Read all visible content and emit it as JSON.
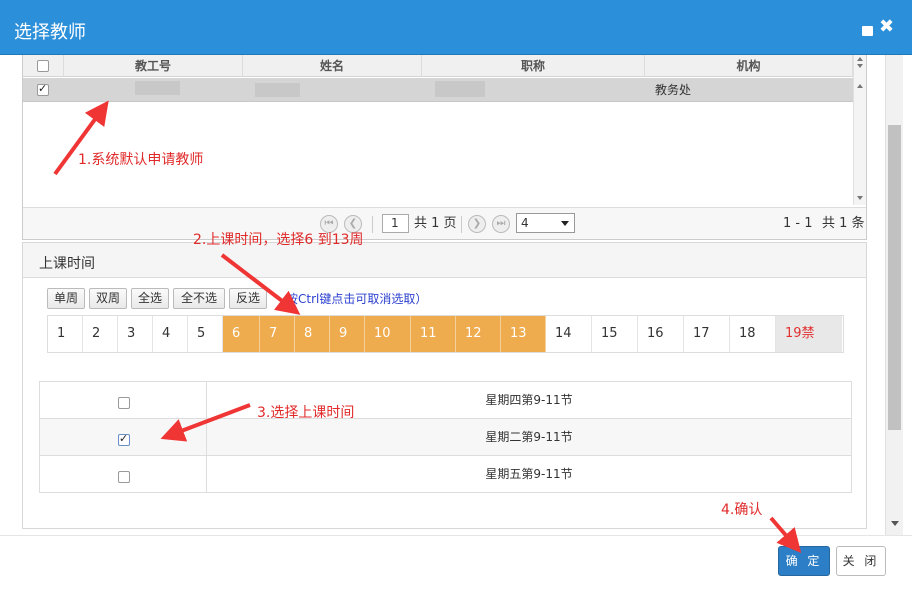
{
  "dialog": {
    "title": "选择教师",
    "icons": {
      "maximize": "square-icon",
      "close": "close-x-icon"
    }
  },
  "teacher_grid": {
    "columns": [
      "教工号",
      "姓名",
      "职称",
      "机构"
    ],
    "rows": [
      {
        "checked": true,
        "id": "",
        "name": "",
        "title": "",
        "org": "教务处"
      }
    ]
  },
  "pager": {
    "page": "1",
    "total_pages_text": "共 1 页",
    "page_size": "4",
    "range_text": "1 - 1",
    "total_text": "共 1 条"
  },
  "time_panel": {
    "title": "上课时间",
    "buttons": [
      "单周",
      "双周",
      "全选",
      "全不选",
      "反选"
    ],
    "hint": "按Ctrl键点击可取消选取）",
    "weeks": [
      {
        "label": "1",
        "state": "normal"
      },
      {
        "label": "2",
        "state": "normal"
      },
      {
        "label": "3",
        "state": "normal"
      },
      {
        "label": "4",
        "state": "normal"
      },
      {
        "label": "5",
        "state": "normal"
      },
      {
        "label": "6",
        "state": "selected"
      },
      {
        "label": "7",
        "state": "selected"
      },
      {
        "label": "8",
        "state": "selected"
      },
      {
        "label": "9",
        "state": "selected"
      },
      {
        "label": "10",
        "state": "selected"
      },
      {
        "label": "11",
        "state": "selected"
      },
      {
        "label": "12",
        "state": "selected"
      },
      {
        "label": "13",
        "state": "selected"
      },
      {
        "label": "14",
        "state": "normal"
      },
      {
        "label": "15",
        "state": "normal"
      },
      {
        "label": "16",
        "state": "normal"
      },
      {
        "label": "17",
        "state": "normal"
      },
      {
        "label": "18",
        "state": "normal"
      },
      {
        "label": "19禁",
        "state": "disabled"
      }
    ],
    "slots": [
      {
        "checked": false,
        "label": "星期四第9-11节"
      },
      {
        "checked": true,
        "label": "星期二第9-11节"
      },
      {
        "checked": false,
        "label": "星期五第9-11节"
      }
    ]
  },
  "footer": {
    "ok_label": "确 定",
    "close_label": "关 闭"
  },
  "annotations": {
    "a1": "1.系统默认申请教师",
    "a2": "2.上课时间，选择6 到13周",
    "a3": "3.选择上课时间",
    "a4": "4.确认"
  },
  "colors": {
    "title_bar": "#2c8fd9",
    "week_selected": "#efac4e",
    "annotation": "#e02a2a",
    "ok_button": "#2c7fc6"
  }
}
